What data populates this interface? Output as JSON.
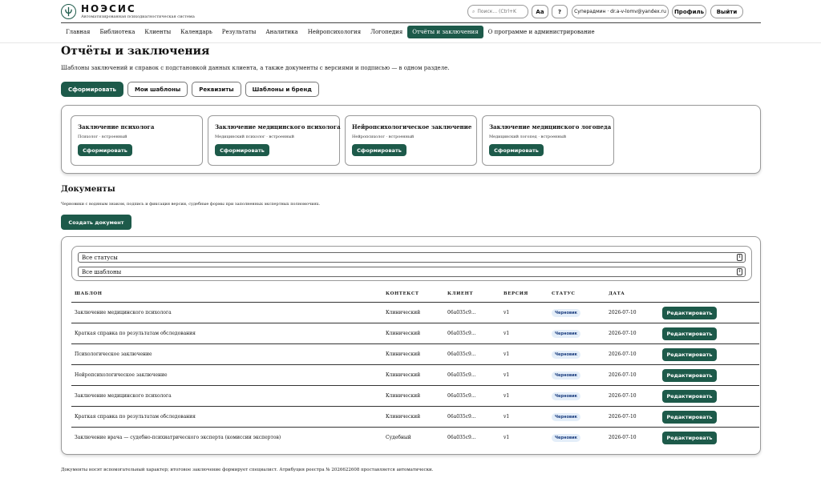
{
  "app": {
    "name": "НОЭСИС",
    "tagline": "Автоматизированная психодиагностическая система"
  },
  "header": {
    "search_placeholder": "Поиск... (Ctrl+K",
    "font_btn": "Aa",
    "help_btn": "?",
    "user": "Суперадмин · dr.a-v-lomv@yandex.ru",
    "profile_btn": "Профиль",
    "logout_btn": "Выйти"
  },
  "nav": [
    {
      "label": "Главная"
    },
    {
      "label": "Библиотека"
    },
    {
      "label": "Клиенты"
    },
    {
      "label": "Календарь"
    },
    {
      "label": "Результаты"
    },
    {
      "label": "Аналитика"
    },
    {
      "label": "Нейропсихология"
    },
    {
      "label": "Логопедия"
    },
    {
      "label": "Отчёты и заключения"
    },
    {
      "label": "О программе и администрирование"
    }
  ],
  "page": {
    "title": "Отчёты и заключения",
    "subtitle": "Шаблоны заключений и справок с подстановкой данных клиента, а также документы с версиями и подписью — в одном разделе."
  },
  "tabs": [
    {
      "label": "Сформировать"
    },
    {
      "label": "Мои шаблоны"
    },
    {
      "label": "Реквизиты"
    },
    {
      "label": "Шаблоны и бренд"
    }
  ],
  "templates": [
    {
      "title": "Заключение психолога",
      "sub": "Психолог · встроенный",
      "btn": "Сформировать"
    },
    {
      "title": "Заключение медицинского психолога",
      "sub": "Медицинский психолог · встроенный",
      "btn": "Сформировать"
    },
    {
      "title": "Нейропсихологическое заключение",
      "sub": "Нейропсихолог · встроенный",
      "btn": "Сформировать"
    },
    {
      "title": "Заключение медицинского логопеда",
      "sub": "Медицинский логопед · встроенный",
      "btn": "Сформировать"
    }
  ],
  "documents": {
    "title": "Документы",
    "subtitle": "Черновики с водяным знаком, подпись и фиксация версии, судебные формы при заполненных экспертных полномочиях.",
    "create_btn": "Создать документ",
    "filter_status": "Все статусы",
    "filter_template": "Все шаблоны",
    "columns": {
      "template": "ШАБЛОН",
      "context": "КОНТЕКСТ",
      "client": "КЛИЕНТ",
      "version": "ВЕРСИЯ",
      "status": "СТАТУС",
      "date": "ДАТА"
    },
    "rows": [
      {
        "template": "Заключение медицинского психолога",
        "context": "Клинический",
        "client": "06a035c9...",
        "version": "v1",
        "status": "Черновик",
        "date": "2026-07-10",
        "action": "Редактировать"
      },
      {
        "template": "Краткая справка по результатам обследования",
        "context": "Клинический",
        "client": "06a035c9...",
        "version": "v1",
        "status": "Черновик",
        "date": "2026-07-10",
        "action": "Редактировать"
      },
      {
        "template": "Психологическое заключение",
        "context": "Клинический",
        "client": "06a035c9...",
        "version": "v1",
        "status": "Черновик",
        "date": "2026-07-10",
        "action": "Редактировать"
      },
      {
        "template": "Нейропсихологическое заключение",
        "context": "Клинический",
        "client": "06a035c9...",
        "version": "v1",
        "status": "Черновик",
        "date": "2026-07-10",
        "action": "Редактировать"
      },
      {
        "template": "Заключение медицинского психолога",
        "context": "Клинический",
        "client": "06a035c9...",
        "version": "v1",
        "status": "Черновик",
        "date": "2026-07-10",
        "action": "Редактировать"
      },
      {
        "template": "Краткая справка по результатам обследования",
        "context": "Клинический",
        "client": "06a035c9...",
        "version": "v1",
        "status": "Черновик",
        "date": "2026-07-10",
        "action": "Редактировать"
      },
      {
        "template": "Заключение врача — судебно-психиатрического эксперта (комиссии экспертов)",
        "context": "Судебный",
        "client": "06a035c9...",
        "version": "v1",
        "status": "Черновик",
        "date": "2026-07-10",
        "action": "Редактировать"
      }
    ]
  },
  "footer": {
    "note": "Документы носят вспомогательный характер; итоговое заключение формирует специалист. Атрибуция реестра № 2026622608 проставляется автоматически."
  },
  "colors": {
    "accent": "#1d5a4a",
    "badge_bg": "#e4eef9",
    "badge_text": "#1d3f80"
  }
}
